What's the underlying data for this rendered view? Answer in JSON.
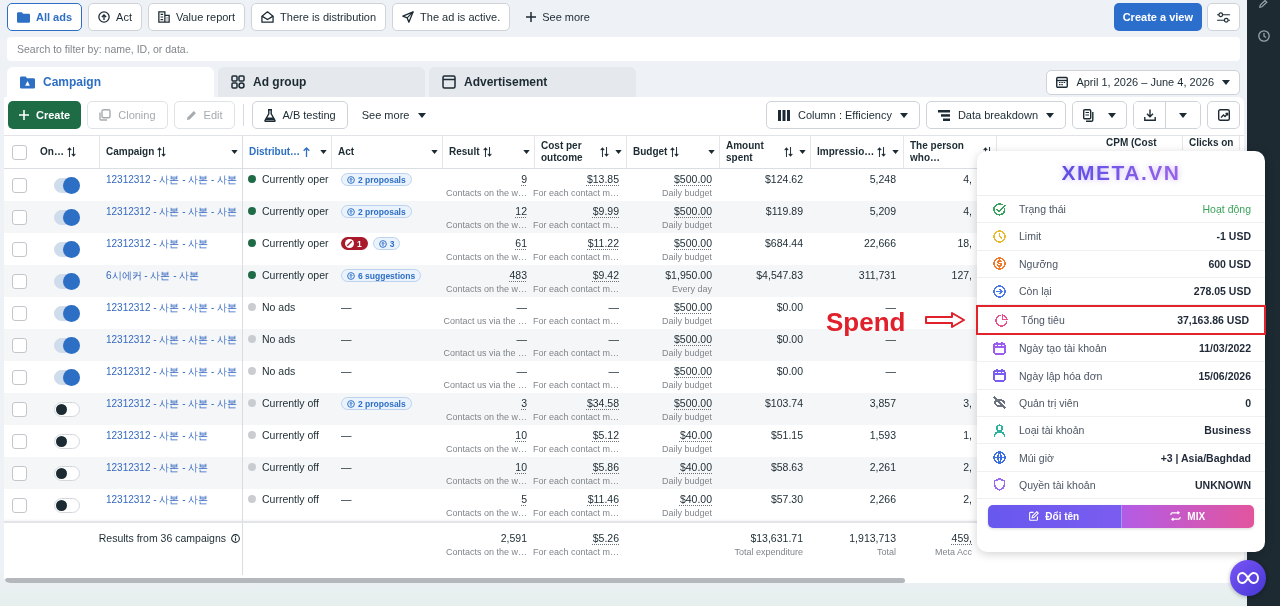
{
  "filter_chips": [
    {
      "label": "All ads",
      "selected": true
    },
    {
      "label": "Act",
      "selected": false
    },
    {
      "label": "Value report",
      "selected": false
    },
    {
      "label": "There is distribution",
      "selected": false
    },
    {
      "label": "The ad is active.",
      "selected": false
    }
  ],
  "see_more_filters": "See more",
  "create_view": "Create a view",
  "search": {
    "placeholder": "Search to filter by: name, ID, or data."
  },
  "level_tabs": [
    {
      "label": "Campaign",
      "selected": true
    },
    {
      "label": "Ad group",
      "selected": false
    },
    {
      "label": "Advertisement",
      "selected": false
    }
  ],
  "date_range": "April 1, 2026 – June 4, 2026",
  "toolbar": {
    "buttons": [
      {
        "label": "Create",
        "kind": "primary",
        "disabled": false
      },
      {
        "label": "Cloning",
        "kind": "secondary",
        "disabled": true
      },
      {
        "label": "Edit",
        "kind": "secondary",
        "disabled": true
      },
      {
        "label": "A/B testing",
        "kind": "secondary",
        "disabled": false
      }
    ],
    "see_more": "See more",
    "column_preset": "Column : Efficiency",
    "breakdown": "Data breakdown"
  },
  "table": {
    "header_checked": false,
    "columns": [
      {
        "label": "On…",
        "sortable": true,
        "sorted": false,
        "menu": false
      },
      {
        "label": "Campaign",
        "sortable": true,
        "sorted": false,
        "menu": true
      },
      {
        "label": "Distribut…",
        "sortable": true,
        "sorted": true,
        "menu": true
      },
      {
        "label": "Act",
        "sortable": false,
        "sorted": false,
        "menu": true
      },
      {
        "label": "Result",
        "sortable": true,
        "sorted": false,
        "menu": true
      },
      {
        "label": "Cost per outcome",
        "sortable": true,
        "sorted": false,
        "menu": true
      },
      {
        "label": "Budget",
        "sortable": true,
        "sorted": false,
        "menu": true
      },
      {
        "label": "Amount spent",
        "sortable": true,
        "sorted": false,
        "menu": true
      },
      {
        "label": "Impressio…",
        "sortable": true,
        "sorted": false,
        "menu": true
      },
      {
        "label": "The person who…",
        "sortable": true,
        "sorted": false,
        "menu": false
      },
      {
        "label": "CPM (Cost",
        "sortable": false,
        "sorted": false,
        "menu": false
      },
      {
        "label": "Clicks on",
        "sortable": false,
        "sorted": false,
        "menu": false
      }
    ],
    "rows": [
      {
        "checked": false,
        "on": true,
        "campaign": "12312312 - 사본 - 사본 - 사본",
        "delivery": {
          "label": "Currently oper",
          "color": "#1f6b48"
        },
        "act": [
          {
            "kind": "suggestion",
            "label": "2 proposals"
          }
        ],
        "result": {
          "value": "9",
          "note": "Contacts on the w…",
          "underlined": true
        },
        "cost": {
          "value": "$13.85",
          "note": "For each contact m…",
          "underlined": true
        },
        "budget": {
          "value": "$500.00",
          "note": "Daily budget",
          "underlined": true
        },
        "spent": "$124.62",
        "impressions": "5,248",
        "reach": "4,"
      },
      {
        "checked": false,
        "on": true,
        "campaign": "12312312 - 사본 - 사본 - 사본",
        "delivery": {
          "label": "Currently oper",
          "color": "#1f6b48"
        },
        "act": [
          {
            "kind": "suggestion",
            "label": "2 proposals"
          }
        ],
        "result": {
          "value": "12",
          "note": "Contacts on the w…",
          "underlined": true
        },
        "cost": {
          "value": "$9.99",
          "note": "For each contact m…",
          "underlined": true
        },
        "budget": {
          "value": "$500.00",
          "note": "Daily budget",
          "underlined": true
        },
        "spent": "$119.89",
        "impressions": "5,209",
        "reach": "4,"
      },
      {
        "checked": false,
        "on": true,
        "campaign": "12312312 - 사본 - 사본",
        "delivery": {
          "label": "Currently oper",
          "color": "#1f6b48"
        },
        "act": [
          {
            "kind": "error",
            "label": "1"
          },
          {
            "kind": "suggestion",
            "label": "3"
          }
        ],
        "result": {
          "value": "61",
          "note": "Contacts on the w…",
          "underlined": true
        },
        "cost": {
          "value": "$11.22",
          "note": "For each contact m…",
          "underlined": true
        },
        "budget": {
          "value": "$500.00",
          "note": "Daily budget",
          "underlined": true
        },
        "spent": "$684.44",
        "impressions": "22,666",
        "reach": "18,"
      },
      {
        "checked": false,
        "on": true,
        "campaign": "6시에커 - 사본 - 사본",
        "delivery": {
          "label": "Currently oper",
          "color": "#1f6b48"
        },
        "act": [
          {
            "kind": "suggestion",
            "label": "6 suggestions"
          }
        ],
        "result": {
          "value": "483",
          "note": "Contacts on the w…",
          "underlined": true
        },
        "cost": {
          "value": "$9.42",
          "note": "For each contact m…",
          "underlined": true
        },
        "budget": {
          "value": "$1,950.00",
          "note": "Every day",
          "underlined": false
        },
        "spent": "$4,547.83",
        "impressions": "311,731",
        "reach": "127,"
      },
      {
        "checked": false,
        "on": true,
        "campaign": "12312312 - 사본 - 사본 - 사본",
        "delivery": {
          "label": "No ads",
          "color": "#c9ccd1"
        },
        "act": [
          {
            "kind": "dash",
            "label": "—"
          }
        ],
        "result": {
          "value": "—",
          "note": "Contact us via the …",
          "underlined": false
        },
        "cost": {
          "value": "—",
          "note": "For each contact m…",
          "underlined": false
        },
        "budget": {
          "value": "$500.00",
          "note": "Daily budget",
          "underlined": true
        },
        "spent": "$0.00",
        "impressions": "—"
      },
      {
        "checked": false,
        "on": true,
        "campaign": "12312312 - 사본 - 사본 - 사본",
        "delivery": {
          "label": "No ads",
          "color": "#c9ccd1"
        },
        "act": [
          {
            "kind": "dash",
            "label": "—"
          }
        ],
        "result": {
          "value": "—",
          "note": "Contact us via the …",
          "underlined": false
        },
        "cost": {
          "value": "—",
          "note": "For each contact m…",
          "underlined": false
        },
        "budget": {
          "value": "$500.00",
          "note": "Daily budget",
          "underlined": true
        },
        "spent": "$0.00",
        "impressions": "—"
      },
      {
        "checked": false,
        "on": true,
        "campaign": "12312312 - 사본 - 사본 - 사본",
        "delivery": {
          "label": "No ads",
          "color": "#c9ccd1"
        },
        "act": [
          {
            "kind": "dash",
            "label": "—"
          }
        ],
        "result": {
          "value": "—",
          "note": "Contact us via the …",
          "underlined": false
        },
        "cost": {
          "value": "—",
          "note": "For each contact m…",
          "underlined": false
        },
        "budget": {
          "value": "$500.00",
          "note": "Daily budget",
          "underlined": true
        },
        "spent": "$0.00",
        "impressions": "—"
      },
      {
        "checked": false,
        "on": false,
        "campaign": "12312312 - 사본 - 사본 - 사본",
        "delivery": {
          "label": "Currently off",
          "color": "#c9ccd1"
        },
        "act": [
          {
            "kind": "suggestion",
            "label": "2 proposals"
          }
        ],
        "result": {
          "value": "3",
          "note": "Contacts on the w…",
          "underlined": true
        },
        "cost": {
          "value": "$34.58",
          "note": "For each contact m…",
          "underlined": true
        },
        "budget": {
          "value": "$500.00",
          "note": "Daily budget",
          "underlined": true
        },
        "spent": "$103.74",
        "impressions": "3,857",
        "reach": "3,"
      },
      {
        "checked": false,
        "on": false,
        "campaign": "12312312 - 사본 - 사본",
        "delivery": {
          "label": "Currently off",
          "color": "#c9ccd1"
        },
        "act": [
          {
            "kind": "dash",
            "label": "—"
          }
        ],
        "result": {
          "value": "10",
          "note": "Contacts on the w…",
          "underlined": true
        },
        "cost": {
          "value": "$5.12",
          "note": "For each contact m…",
          "underlined": true
        },
        "budget": {
          "value": "$40.00",
          "note": "Daily budget",
          "underlined": true
        },
        "spent": "$51.15",
        "impressions": "1,593",
        "reach": "1,"
      },
      {
        "checked": false,
        "on": false,
        "campaign": "12312312 - 사본 - 사본",
        "delivery": {
          "label": "Currently off",
          "color": "#c9ccd1"
        },
        "act": [
          {
            "kind": "dash",
            "label": "—"
          }
        ],
        "result": {
          "value": "10",
          "note": "Contacts on the w…",
          "underlined": true
        },
        "cost": {
          "value": "$5.86",
          "note": "For each contact m…",
          "underlined": true
        },
        "budget": {
          "value": "$40.00",
          "note": "Daily budget",
          "underlined": true
        },
        "spent": "$58.63",
        "impressions": "2,261",
        "reach": "2,"
      },
      {
        "checked": false,
        "on": false,
        "campaign": "12312312 - 사본 - 사본",
        "delivery": {
          "label": "Currently off",
          "color": "#c9ccd1"
        },
        "act": [
          {
            "kind": "dash",
            "label": "—"
          }
        ],
        "result": {
          "value": "5",
          "note": "Contacts on the w…",
          "underlined": true
        },
        "cost": {
          "value": "$11.46",
          "note": "For each contact m…",
          "underlined": true
        },
        "budget": {
          "value": "$40.00",
          "note": "Daily budget",
          "underlined": true
        },
        "spent": "$57.30",
        "impressions": "2,266",
        "reach": "2,"
      }
    ],
    "footer": {
      "label": "Results from 36 campaigns",
      "result": {
        "value": "2,591",
        "note": "Contacts on the w…",
        "underlined": false
      },
      "cost": {
        "value": "$5.26",
        "note": "For each contact m…",
        "underlined": true
      },
      "spent": {
        "value": "$13,631.71",
        "note": "Total expenditure",
        "underlined": false
      },
      "impressions": {
        "value": "1,913,713",
        "note": "Total",
        "underlined": false
      },
      "reach": {
        "value": "459,",
        "note": "Meta Acc",
        "underlined": true
      }
    }
  },
  "annotation": {
    "label": "Spend"
  },
  "account_panel": {
    "brand": "XMETA.VN",
    "rows": [
      {
        "label": "Trạng thái",
        "value": "Hoạt động",
        "color": "#3aa35b",
        "kind": "status",
        "highlighted": false
      },
      {
        "label": "Limit",
        "value": "-1 USD",
        "color": "#e9b92f",
        "kind": "field",
        "highlighted": false
      },
      {
        "label": "Ngưỡng",
        "value": "600 USD",
        "color": "#f0792b",
        "kind": "field",
        "highlighted": false
      },
      {
        "label": "Còn lại",
        "value": "278.05 USD",
        "color": "#4a78e6",
        "kind": "field",
        "highlighted": false
      },
      {
        "label": "Tổng tiêu",
        "value": "37,163.86 USD",
        "color": "#e8508a",
        "kind": "field",
        "highlighted": true
      },
      {
        "label": "Ngày tạo tài khoản",
        "value": "11/03/2022",
        "color": "#9b5cf2",
        "kind": "field",
        "highlighted": false
      },
      {
        "label": "Ngày lập hóa đơn",
        "value": "15/06/2026",
        "color": "#7a5cf0",
        "kind": "field",
        "highlighted": false
      },
      {
        "label": "Quản trị viên",
        "value": "0",
        "color": "#6b7280",
        "kind": "field",
        "highlighted": false
      },
      {
        "label": "Loại tài khoản",
        "value": "Business",
        "color": "#2bb3a0",
        "kind": "field",
        "highlighted": false
      },
      {
        "label": "Múi giờ",
        "value": "+3 | Asia/Baghdad",
        "color": "#3b6fe0",
        "kind": "field",
        "highlighted": false
      },
      {
        "label": "Quyền tài khoản",
        "value": "UNKNOWN",
        "color": "#9b6cf0",
        "kind": "field",
        "highlighted": false
      }
    ],
    "buttons": [
      {
        "label": "Đổi tên"
      },
      {
        "label": "MIX"
      }
    ]
  }
}
